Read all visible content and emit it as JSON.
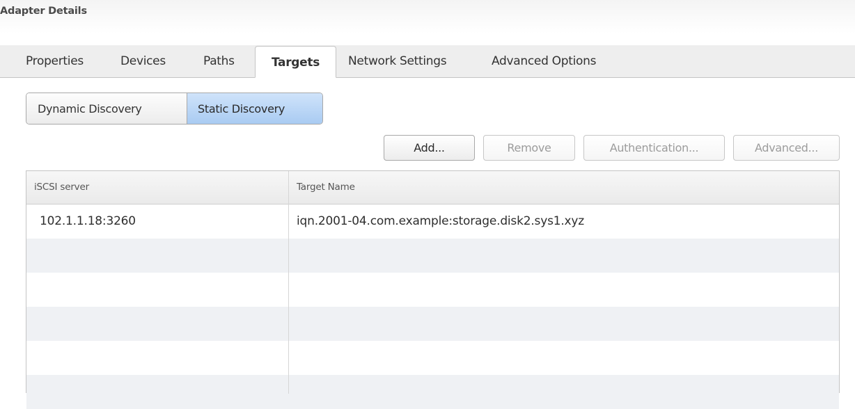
{
  "header": {
    "title": "Adapter Details"
  },
  "tabs": [
    {
      "label": "Properties",
      "active": false
    },
    {
      "label": "Devices",
      "active": false
    },
    {
      "label": "Paths",
      "active": false
    },
    {
      "label": "Targets",
      "active": true
    },
    {
      "label": "Network Settings",
      "active": false
    },
    {
      "label": "Advanced Options",
      "active": false
    }
  ],
  "discovery_toggle": {
    "dynamic_label": "Dynamic Discovery",
    "static_label": "Static Discovery",
    "selected": "Static Discovery"
  },
  "actions": {
    "add_label": "Add...",
    "remove_label": "Remove",
    "authentication_label": "Authentication...",
    "advanced_label": "Advanced..."
  },
  "table": {
    "columns": [
      "iSCSI server",
      "Target Name"
    ],
    "rows": [
      [
        "102.1.1.18:3260",
        "iqn.2001-04.com.example:storage.disk2.sys1.xyz"
      ],
      [
        "",
        ""
      ],
      [
        "",
        ""
      ],
      [
        "",
        ""
      ],
      [
        "",
        ""
      ],
      [
        "",
        ""
      ]
    ]
  },
  "colors": {
    "selected_segment": "#a9cbf2",
    "row_stripe": "#eff1f4",
    "tabbar_bg": "#eeeeee"
  }
}
